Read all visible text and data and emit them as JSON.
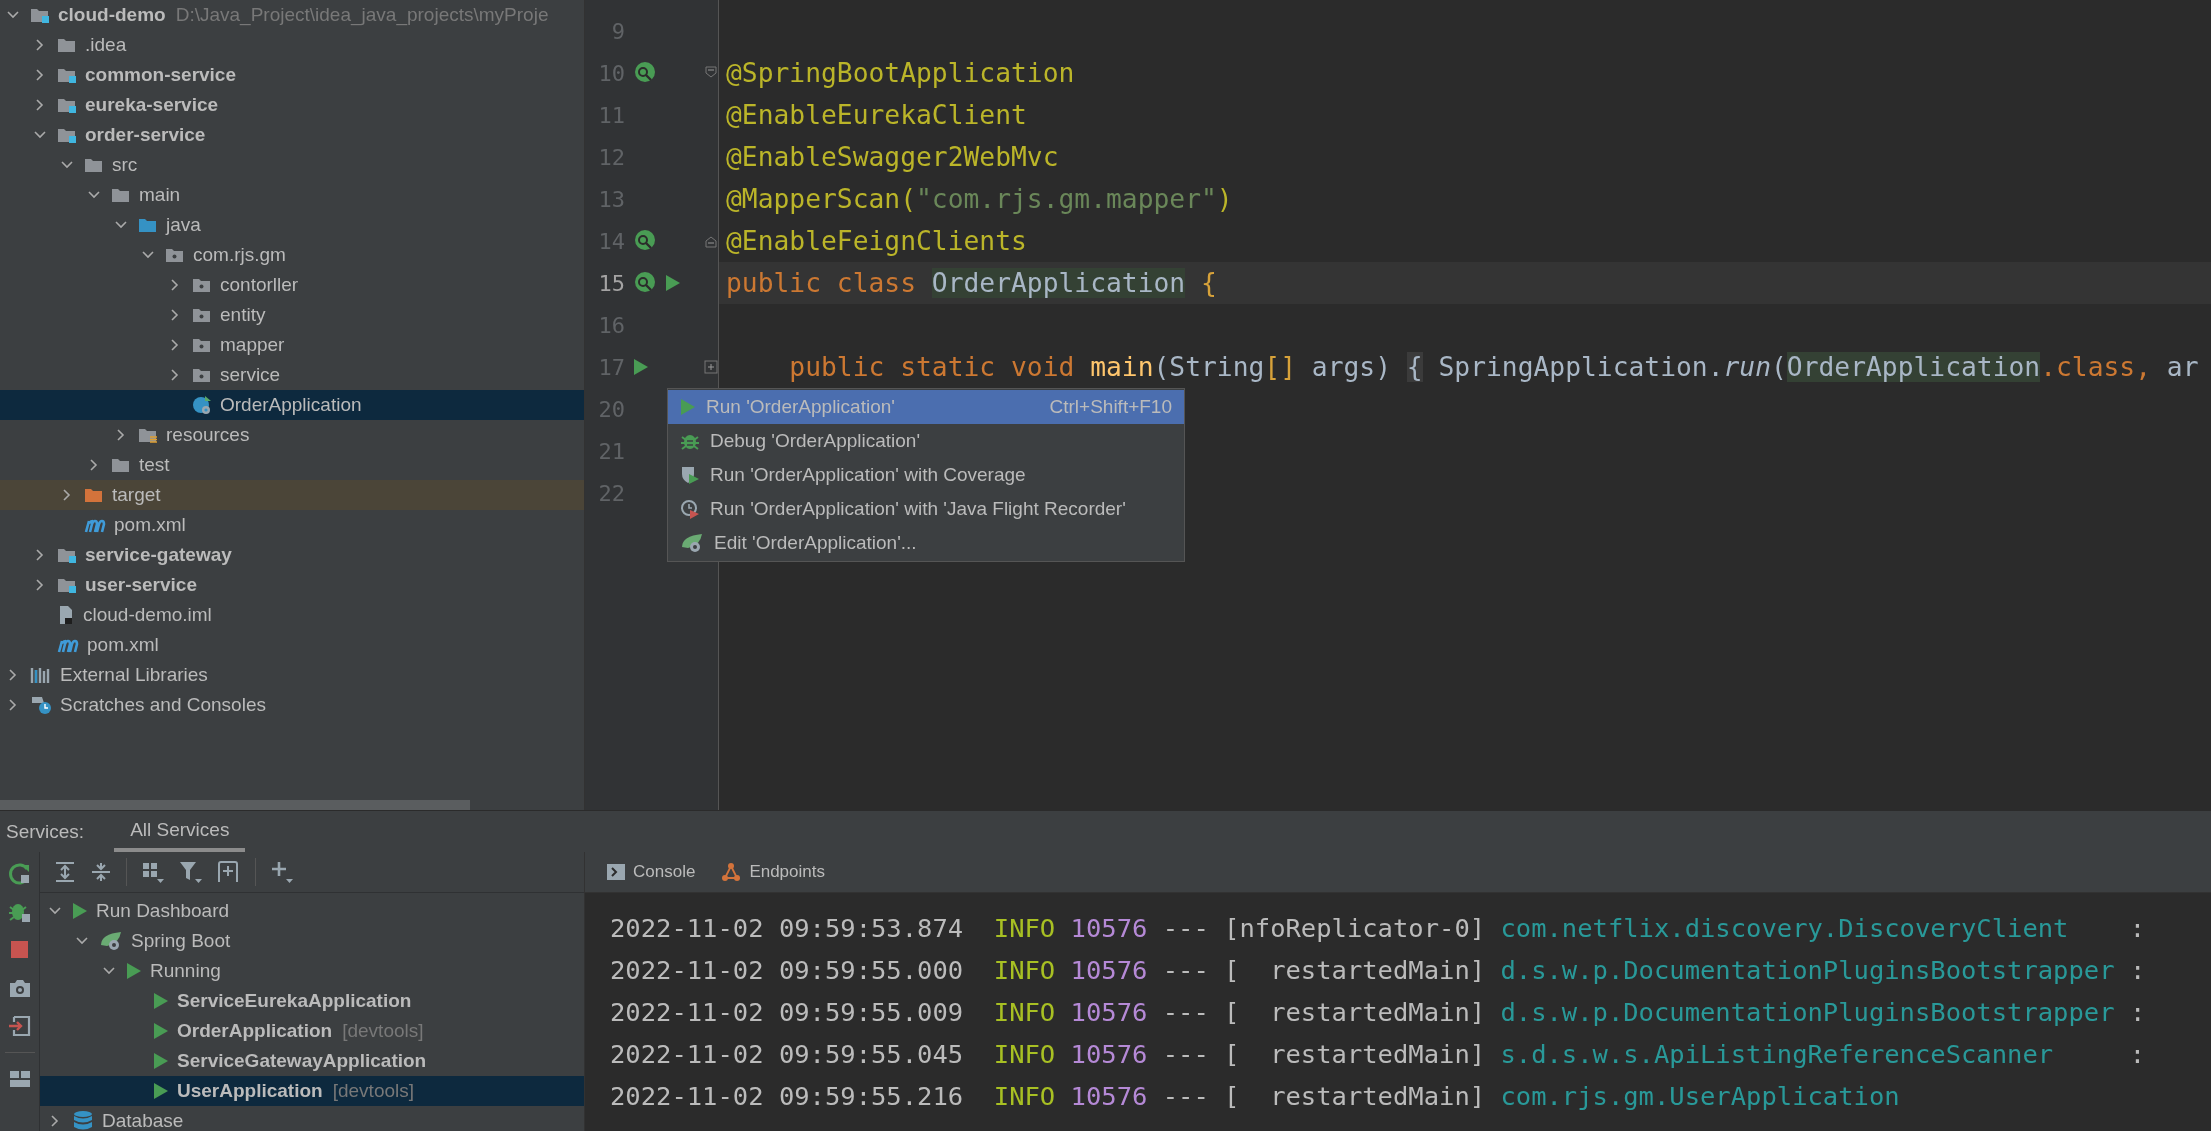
{
  "project_tree": [
    {
      "label": "cloud-demo",
      "detail": "D:\\Java_Project\\idea_java_projects\\myProje",
      "kind": "module",
      "expanded": true,
      "selected": false,
      "children": [
        {
          "label": ".idea",
          "kind": "folder",
          "expanded": false,
          "selected": false
        },
        {
          "label": "common-service",
          "kind": "module",
          "expanded": false,
          "selected": false
        },
        {
          "label": "eureka-service",
          "kind": "module",
          "expanded": false,
          "selected": false
        },
        {
          "label": "order-service",
          "kind": "module",
          "expanded": true,
          "selected": false,
          "children": [
            {
              "label": "src",
              "kind": "folder",
              "expanded": true,
              "selected": false,
              "children": [
                {
                  "label": "main",
                  "kind": "folder",
                  "expanded": true,
                  "selected": false,
                  "children": [
                    {
                      "label": "java",
                      "kind": "source",
                      "expanded": true,
                      "selected": false,
                      "children": [
                        {
                          "label": "com.rjs.gm",
                          "kind": "package",
                          "expanded": true,
                          "selected": false,
                          "children": [
                            {
                              "label": "contorller",
                              "kind": "package",
                              "expanded": false,
                              "selected": false
                            },
                            {
                              "label": "entity",
                              "kind": "package",
                              "expanded": false,
                              "selected": false
                            },
                            {
                              "label": "mapper",
                              "kind": "package",
                              "expanded": false,
                              "selected": false
                            },
                            {
                              "label": "service",
                              "kind": "package",
                              "expanded": false,
                              "selected": false
                            },
                            {
                              "label": "OrderApplication",
                              "kind": "class",
                              "selected": true
                            }
                          ]
                        }
                      ]
                    },
                    {
                      "label": "resources",
                      "kind": "resources",
                      "expanded": false,
                      "selected": false
                    }
                  ]
                },
                {
                  "label": "test",
                  "kind": "folder",
                  "expanded": false,
                  "selected": false
                }
              ]
            },
            {
              "label": "target",
              "kind": "excluded",
              "expanded": false,
              "selected": false
            },
            {
              "label": "pom.xml",
              "kind": "maven",
              "selected": false
            }
          ]
        },
        {
          "label": "service-gateway",
          "kind": "module",
          "expanded": false,
          "selected": false
        },
        {
          "label": "user-service",
          "kind": "module",
          "expanded": false,
          "selected": false
        },
        {
          "label": "cloud-demo.iml",
          "kind": "iml",
          "selected": false
        },
        {
          "label": "pom.xml",
          "kind": "maven",
          "selected": false
        }
      ]
    },
    {
      "label": "External Libraries",
      "kind": "libraries",
      "expanded": false,
      "selected": false
    },
    {
      "label": "Scratches and Consoles",
      "kind": "scratches",
      "expanded": false,
      "selected": false
    }
  ],
  "editor": {
    "lines": [
      {
        "number": "9",
        "current": false
      },
      {
        "number": "10",
        "current": false,
        "bean_marker": true,
        "fold_start": true,
        "tokens": [
          {
            "kind": "annotation",
            "text": "@SpringBootApplication"
          }
        ]
      },
      {
        "number": "11",
        "current": false,
        "tokens": [
          {
            "kind": "annotation",
            "text": "@EnableEurekaClient"
          }
        ]
      },
      {
        "number": "12",
        "current": false,
        "tokens": [
          {
            "kind": "annotation",
            "text": "@EnableSwagger2WebMvc"
          }
        ]
      },
      {
        "number": "13",
        "current": false,
        "tokens": [
          {
            "kind": "annotation",
            "text": "@MapperScan("
          },
          {
            "kind": "string",
            "text": "\"com.rjs.gm.mapper\""
          },
          {
            "kind": "annotation",
            "text": ")"
          }
        ]
      },
      {
        "number": "14",
        "current": false,
        "bean_marker": true,
        "fold_end": true,
        "tokens": [
          {
            "kind": "annotation",
            "text": "@EnableFeignClients"
          }
        ]
      },
      {
        "number": "15",
        "current": true,
        "bean_marker": true,
        "run_marker": true,
        "tokens": [
          {
            "kind": "keyword",
            "text": "public class "
          },
          {
            "kind": "highlight",
            "text": "OrderApplication"
          },
          {
            "kind": "brace",
            "text": " {"
          }
        ]
      },
      {
        "number": "16",
        "current": false
      },
      {
        "number": "17",
        "current": false,
        "run_marker": true,
        "folded": true,
        "tokens": [
          {
            "kind": "keyword",
            "text": "    public static void "
          },
          {
            "kind": "method",
            "text": "main"
          },
          {
            "kind": "plain",
            "text": "(String"
          },
          {
            "kind": "brace",
            "text": "[]"
          },
          {
            "kind": "plain",
            "text": " args) "
          },
          {
            "kind": "folded",
            "text": "{"
          },
          {
            "kind": "plain",
            "text": " SpringApplication."
          },
          {
            "kind": "call",
            "text": "run"
          },
          {
            "kind": "plain",
            "text": "("
          },
          {
            "kind": "highlight",
            "text": "OrderApplication"
          },
          {
            "kind": "keyword",
            "text": ".class, "
          },
          {
            "kind": "plain",
            "text": "ar"
          }
        ]
      },
      {
        "number": "20",
        "current": false
      },
      {
        "number": "21",
        "current": false
      },
      {
        "number": "22",
        "current": false
      }
    ]
  },
  "context_menu": {
    "items": [
      {
        "label": "Run 'OrderApplication'",
        "shortcut": "Ctrl+Shift+F10",
        "kind": "run",
        "selected": true
      },
      {
        "label": "Debug 'OrderApplication'",
        "kind": "debug",
        "selected": false
      },
      {
        "label": "Run 'OrderApplication' with Coverage",
        "kind": "coverage",
        "selected": false
      },
      {
        "label": "Run 'OrderApplication' with 'Java Flight Recorder'",
        "kind": "profiler",
        "selected": false
      },
      {
        "label": "Edit 'OrderApplication'...",
        "kind": "edit",
        "selected": false
      }
    ]
  },
  "services": {
    "title": "Services:",
    "tabs": [
      {
        "label": "All Services",
        "selected": true
      }
    ],
    "tree": [
      {
        "label": "Run Dashboard",
        "kind": "dashboard",
        "expanded": true,
        "selected": false,
        "children": [
          {
            "label": "Spring Boot",
            "kind": "spring",
            "expanded": true,
            "selected": false,
            "children": [
              {
                "label": "Running",
                "kind": "group",
                "expanded": true,
                "selected": false,
                "children": [
                  {
                    "label": "ServiceEurekaApplication",
                    "kind": "app",
                    "selected": false
                  },
                  {
                    "label": "OrderApplication",
                    "note": "[devtools]",
                    "kind": "app",
                    "selected": false
                  },
                  {
                    "label": "ServiceGatewayApplication",
                    "kind": "app",
                    "selected": false
                  },
                  {
                    "label": "UserApplication",
                    "note": "[devtools]",
                    "kind": "app",
                    "selected": true
                  }
                ]
              }
            ]
          }
        ]
      },
      {
        "label": "Database",
        "kind": "database",
        "expanded": false,
        "selected": false
      }
    ]
  },
  "console": {
    "tabs": [
      {
        "label": "Console",
        "kind": "console"
      },
      {
        "label": "Endpoints",
        "kind": "endpoints"
      }
    ],
    "lines": [
      {
        "time": "2022-11-02 09:59:53.874",
        "level": "INFO",
        "pid": "10576",
        "separator": "---",
        "thread": "[nfoReplicator-0]",
        "logger": "com.netflix.discovery.DiscoveryClient",
        "tail": ":"
      },
      {
        "time": "2022-11-02 09:59:55.000",
        "level": "INFO",
        "pid": "10576",
        "separator": "---",
        "thread": "[  restartedMain]",
        "logger": "d.s.w.p.DocumentationPluginsBootstrapper",
        "tail": ":"
      },
      {
        "time": "2022-11-02 09:59:55.009",
        "level": "INFO",
        "pid": "10576",
        "separator": "---",
        "thread": "[  restartedMain]",
        "logger": "d.s.w.p.DocumentationPluginsBootstrapper",
        "tail": ":"
      },
      {
        "time": "2022-11-02 09:59:55.045",
        "level": "INFO",
        "pid": "10576",
        "separator": "---",
        "thread": "[  restartedMain]",
        "logger": "s.d.s.w.s.ApiListingReferenceScanner",
        "tail": ":"
      },
      {
        "time": "2022-11-02 09:59:55.216",
        "level": "INFO",
        "pid": "10576",
        "separator": "---",
        "thread": "[  restartedMain]",
        "logger": "com.rjs.gm.UserApplication"
      }
    ]
  }
}
